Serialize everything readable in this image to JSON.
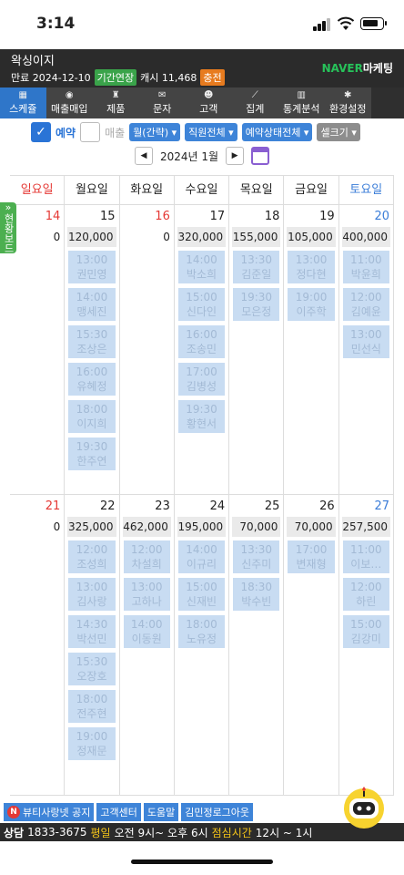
{
  "status": {
    "time": "3:14"
  },
  "header": {
    "shop_name": "왁싱이지",
    "expiry_label": "만료 2024-12-10",
    "extend_label": "기간연장",
    "cash_label": "캐시 11,468",
    "charge_label": "충전",
    "brand_naver": "NAVER",
    "brand_marketing": "마케팅"
  },
  "menu": [
    {
      "label": "스케쥴",
      "icon": "calendar-icon"
    },
    {
      "label": "매출매입",
      "icon": "coin-icon"
    },
    {
      "label": "제품",
      "icon": "product-icon"
    },
    {
      "label": "문자",
      "icon": "mail-icon"
    },
    {
      "label": "고객",
      "icon": "people-icon"
    },
    {
      "label": "집계",
      "icon": "graph-icon"
    },
    {
      "label": "통계분석",
      "icon": "barchart-icon"
    },
    {
      "label": "환경설정",
      "icon": "settings-icon"
    }
  ],
  "filters": {
    "reservation_label": "예약",
    "sales_label": "매출",
    "view_mode": "월(간략)",
    "staff": "직원전체",
    "status": "예약상태전체",
    "cell_size": "셀크기"
  },
  "calendar": {
    "month": "2024년 1월",
    "weekdays": [
      "일요일",
      "월요일",
      "화요일",
      "수요일",
      "목요일",
      "금요일",
      "토요일"
    ],
    "weeks": [
      [
        {
          "date": "14",
          "amount": "0",
          "appts": []
        },
        {
          "date": "15",
          "amount": "120,000",
          "appts": [
            [
              "13:00",
              "권민영"
            ],
            [
              "14:00",
              "맹세진"
            ],
            [
              "15:30",
              "조상은"
            ],
            [
              "16:00",
              "유혜정"
            ],
            [
              "18:00",
              "이지희"
            ],
            [
              "19:30",
              "한주연"
            ]
          ]
        },
        {
          "date": "16",
          "amount": "0",
          "appts": []
        },
        {
          "date": "17",
          "amount": "320,000",
          "appts": [
            [
              "14:00",
              "박소희"
            ],
            [
              "15:00",
              "신다인"
            ],
            [
              "16:00",
              "조송민"
            ],
            [
              "17:00",
              "김병성"
            ],
            [
              "19:30",
              "황현서"
            ]
          ]
        },
        {
          "date": "18",
          "amount": "155,000",
          "appts": [
            [
              "13:30",
              "김준일"
            ],
            [
              "19:30",
              "모은정"
            ]
          ]
        },
        {
          "date": "19",
          "amount": "105,000",
          "appts": [
            [
              "13:00",
              "정다현"
            ],
            [
              "19:00",
              "이주학"
            ]
          ]
        },
        {
          "date": "20",
          "amount": "400,000",
          "appts": [
            [
              "11:00",
              "박윤희"
            ],
            [
              "12:00",
              "김예윤"
            ],
            [
              "13:00",
              "민선식"
            ]
          ]
        }
      ],
      [
        {
          "date": "21",
          "amount": "0",
          "appts": []
        },
        {
          "date": "22",
          "amount": "325,000",
          "appts": [
            [
              "12:00",
              "조성희"
            ],
            [
              "13:00",
              "김사랑"
            ],
            [
              "14:30",
              "박선민"
            ],
            [
              "15:30",
              "오장호"
            ],
            [
              "18:00",
              "전주현"
            ],
            [
              "19:00",
              "정재문"
            ]
          ]
        },
        {
          "date": "23",
          "amount": "462,000",
          "appts": [
            [
              "12:00",
              "차설희"
            ],
            [
              "13:00",
              "고하나"
            ],
            [
              "14:00",
              "이동원"
            ]
          ]
        },
        {
          "date": "24",
          "amount": "195,000",
          "appts": [
            [
              "14:00",
              "이규리"
            ],
            [
              "15:00",
              "신재빈"
            ],
            [
              "18:00",
              "노유정"
            ]
          ]
        },
        {
          "date": "25",
          "amount": "70,000",
          "appts": [
            [
              "13:30",
              "신주미"
            ],
            [
              "18:30",
              "박수빈"
            ]
          ]
        },
        {
          "date": "26",
          "amount": "70,000",
          "appts": [
            [
              "17:00",
              "변재형"
            ]
          ]
        },
        {
          "date": "27",
          "amount": "257,500",
          "appts": [
            [
              "11:00",
              "이보…"
            ],
            [
              "12:00",
              "하린"
            ],
            [
              "15:00",
              "김강미"
            ]
          ]
        }
      ]
    ]
  },
  "side_tab": "현황보드",
  "bottom_links": [
    "뷰티사랑넷 공지",
    "고객센터",
    "도움말",
    "김민정로그아웃"
  ],
  "footer": {
    "consult": "상담",
    "phone": "1833-3675",
    "weekday": "평일",
    "hours": "오전 9시~ 오후 6시",
    "lunch": "점심시간",
    "lunch_hours": "12시 ~ 1시"
  }
}
